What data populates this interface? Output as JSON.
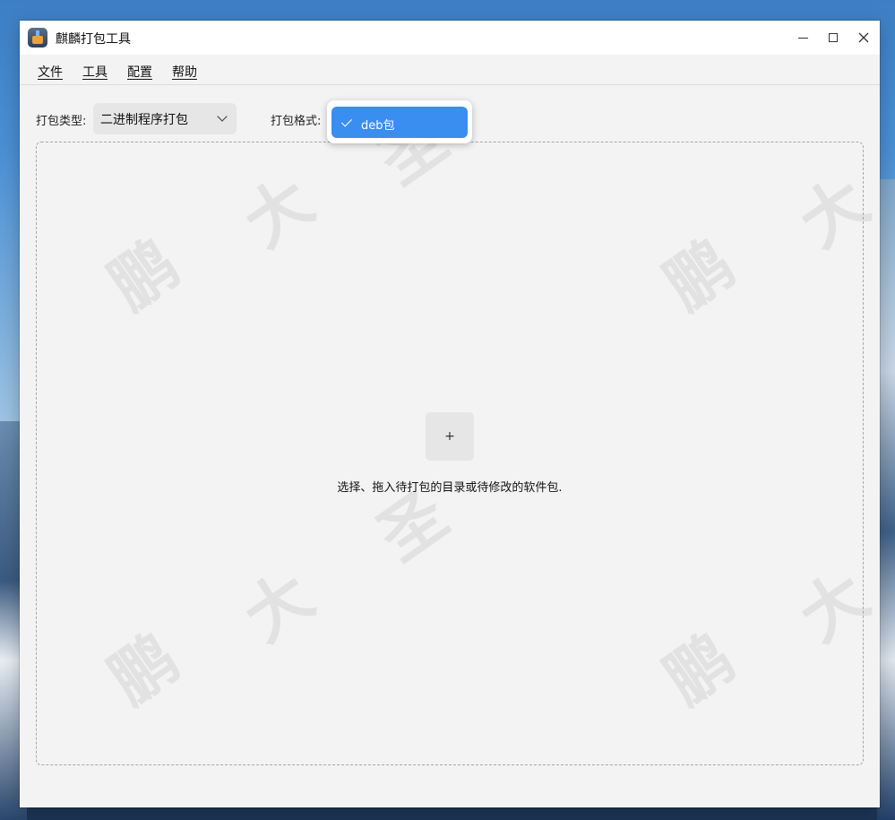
{
  "window": {
    "title": "麒麟打包工具"
  },
  "menubar": {
    "items": [
      {
        "label": "文件"
      },
      {
        "label": "工具"
      },
      {
        "label": "配置"
      },
      {
        "label": "帮助"
      }
    ]
  },
  "toolbar": {
    "pack_type_label": "打包类型:",
    "pack_type_value": "二进制程序打包",
    "pack_format_label": "打包格式:",
    "pack_format_options": [
      {
        "label": "deb包",
        "selected": true
      }
    ]
  },
  "dropzone": {
    "add_button_label": "+",
    "hint": "选择、拖入待打包的目录或待修改的软件包."
  },
  "watermark": [
    "鹏",
    "大",
    "圣",
    "鹏",
    "大",
    "圣",
    "鹏",
    "大",
    "鹏",
    "大"
  ],
  "colors": {
    "accent": "#3a8ef0",
    "window_bg": "#f3f3f3",
    "titlebar_bg": "#ffffff"
  }
}
